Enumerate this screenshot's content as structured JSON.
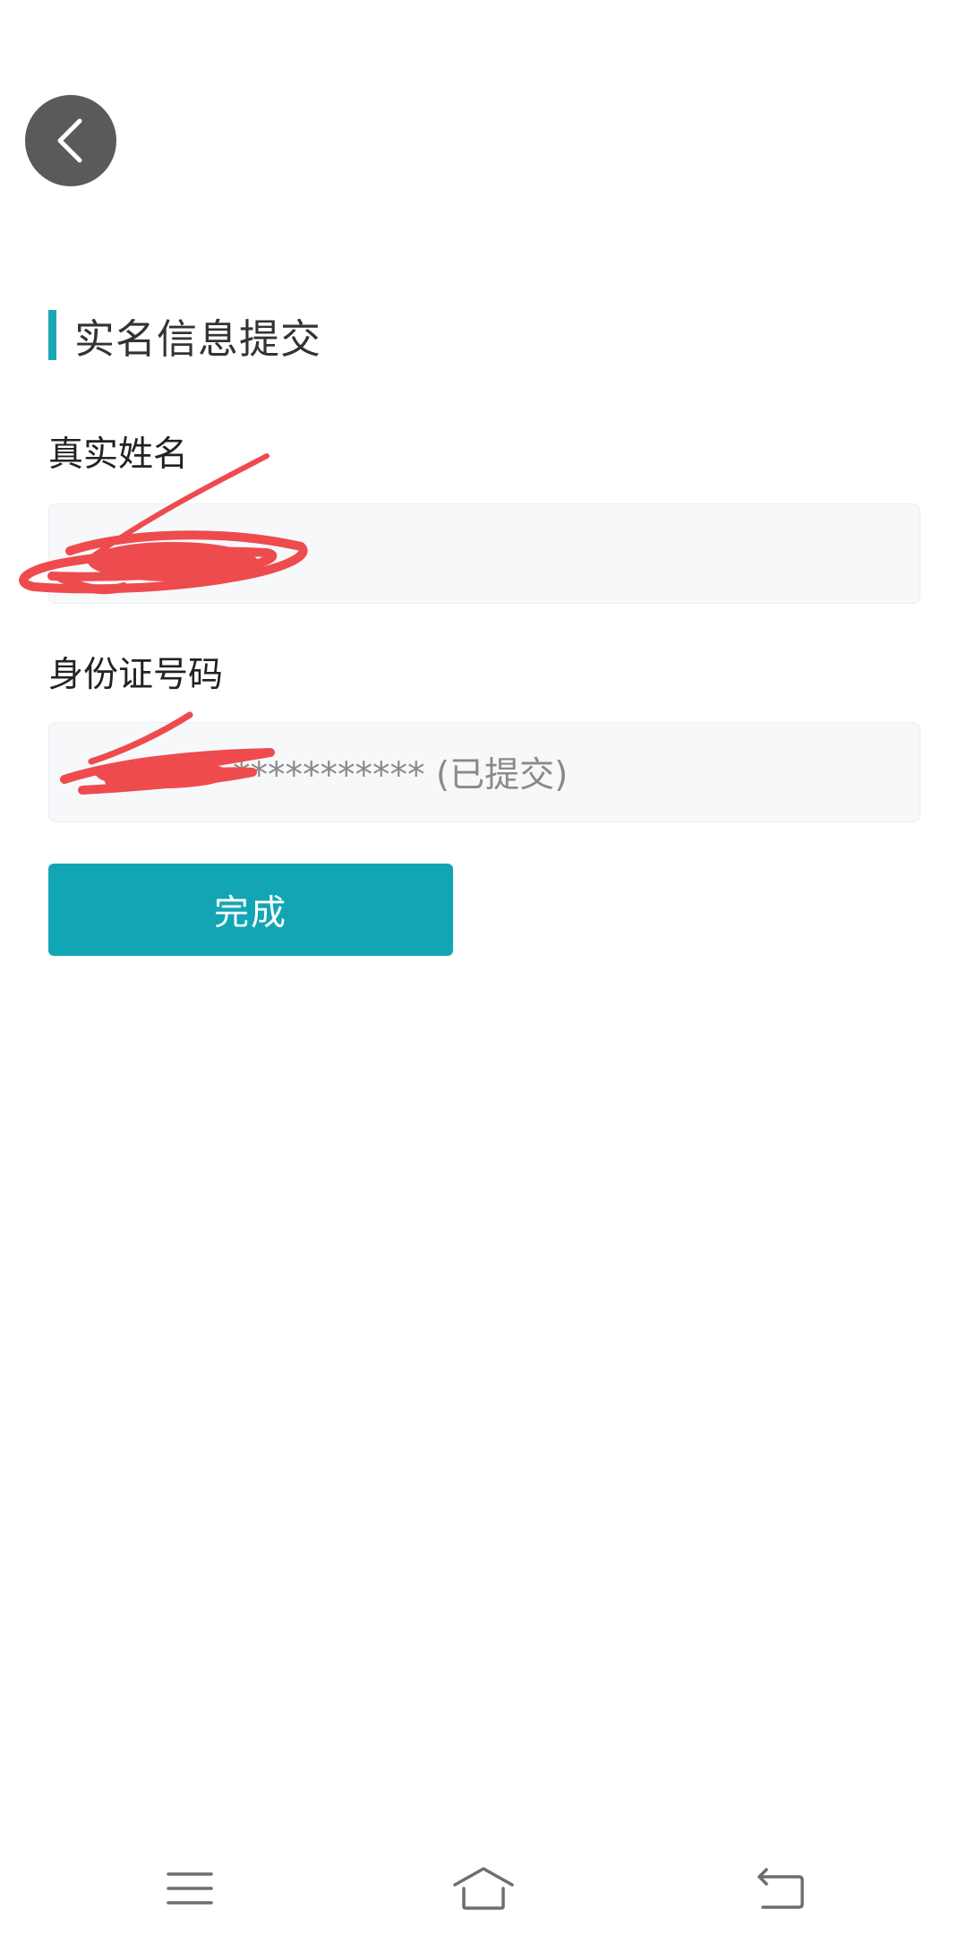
{
  "header": {
    "back_icon": "chevron-left-icon"
  },
  "section": {
    "title": "实名信息提交",
    "accent_color": "#1aa8b6"
  },
  "form": {
    "name_label": "真实姓名",
    "name_value": "",
    "id_label": "身份证号码",
    "id_value": "***********  (已提交)"
  },
  "actions": {
    "done_label": "完成",
    "done_color": "#12a6b4"
  },
  "system_nav": {
    "menu_icon": "menu-icon",
    "home_icon": "home-icon",
    "back_icon": "back-arrow-icon"
  }
}
